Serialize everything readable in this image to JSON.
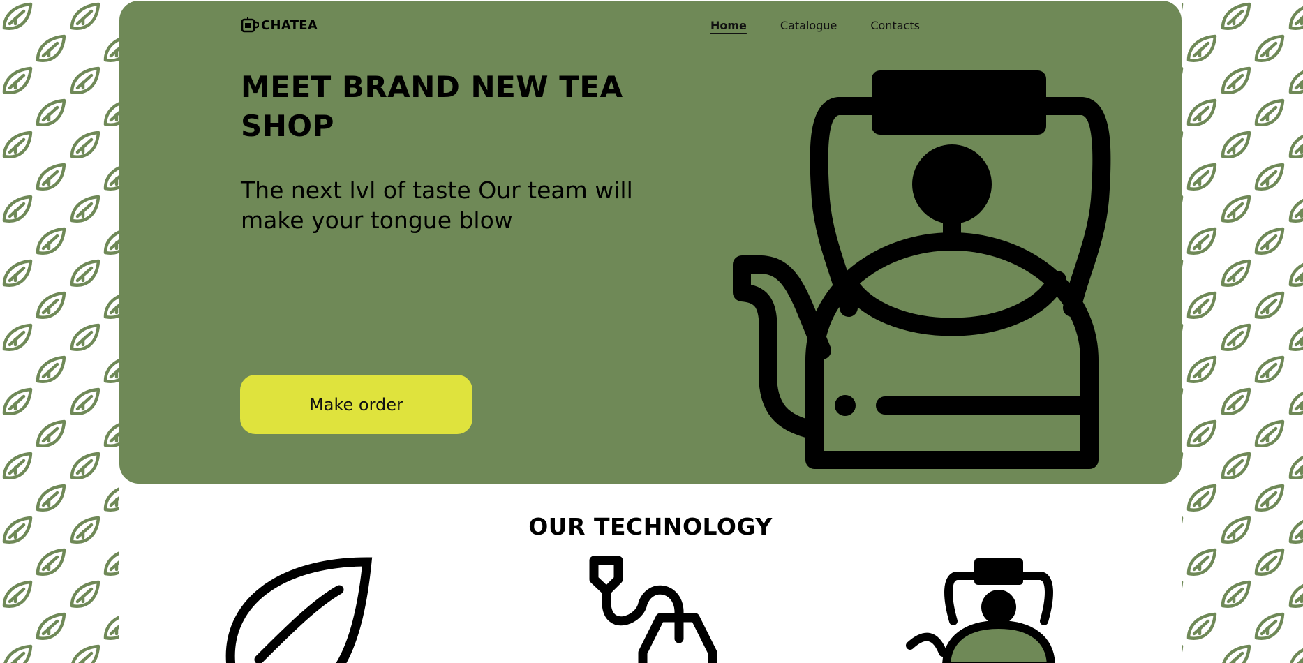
{
  "brand": {
    "name": "CHATEA",
    "logo_icon": "teacup-icon"
  },
  "nav": {
    "items": [
      {
        "label": "Home",
        "active": true
      },
      {
        "label": "Catalogue",
        "active": false
      },
      {
        "label": "Contacts",
        "active": false
      }
    ]
  },
  "hero": {
    "headline": "MEET BRAND NEW TEA SHOP",
    "subheadline": "The next lvl of taste Our team will make your tongue blow",
    "cta_label": "Make order",
    "illustration": "kettle-icon"
  },
  "technology": {
    "title": "OUR TECHNOLOGY",
    "icons": [
      "leaf-icon",
      "tea-bag-icon",
      "kettle-icon"
    ]
  },
  "colors": {
    "hero_background": "#6f8957",
    "button": "#dfe33d",
    "pattern_leaf": "#6f8957",
    "page_background": "#ffffff"
  }
}
